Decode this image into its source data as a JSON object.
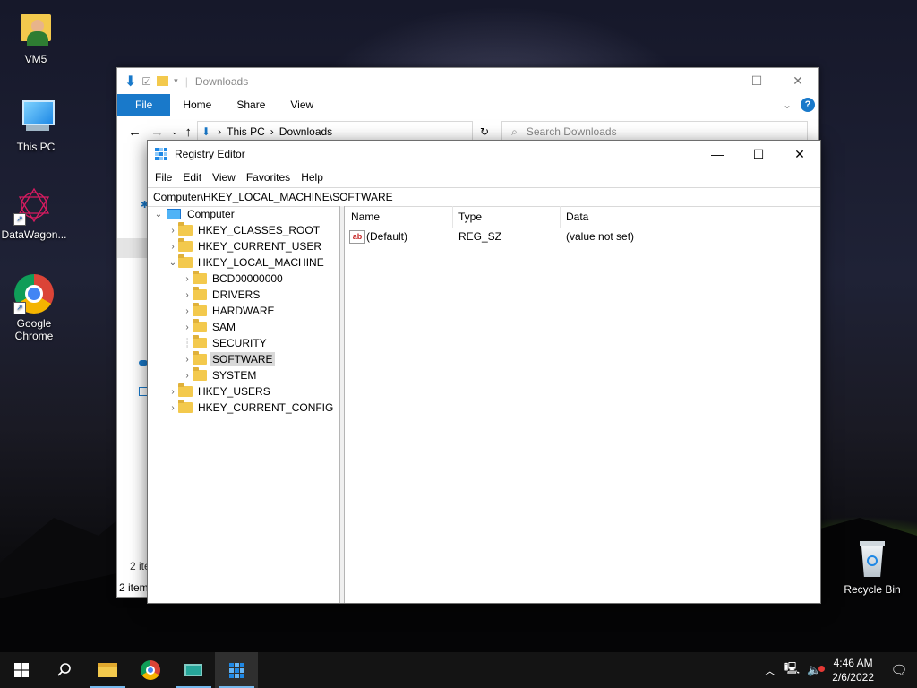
{
  "desktop": {
    "icons": [
      {
        "label": "VM5"
      },
      {
        "label": "This PC"
      },
      {
        "label": "DataWagon..."
      },
      {
        "label": "Google Chrome"
      },
      {
        "label": "Recycle Bin"
      }
    ]
  },
  "explorer": {
    "title": "Downloads",
    "ribbon": {
      "file": "File",
      "home": "Home",
      "share": "Share",
      "view": "View"
    },
    "path": {
      "root": "This PC",
      "current": "Downloads"
    },
    "search_placeholder": "Search Downloads",
    "status_a": "2 ite",
    "status_b": "2 item"
  },
  "regedit": {
    "title": "Registry Editor",
    "menu": {
      "file": "File",
      "edit": "Edit",
      "view": "View",
      "favorites": "Favorites",
      "help": "Help"
    },
    "address": "Computer\\HKEY_LOCAL_MACHINE\\SOFTWARE",
    "tree": {
      "computer": "Computer",
      "hkcr": "HKEY_CLASSES_ROOT",
      "hkcu": "HKEY_CURRENT_USER",
      "hklm": "HKEY_LOCAL_MACHINE",
      "bcd": "BCD00000000",
      "drivers": "DRIVERS",
      "hardware": "HARDWARE",
      "sam": "SAM",
      "security": "SECURITY",
      "software": "SOFTWARE",
      "system": "SYSTEM",
      "hku": "HKEY_USERS",
      "hkcc": "HKEY_CURRENT_CONFIG"
    },
    "columns": {
      "name": "Name",
      "type": "Type",
      "data": "Data"
    },
    "values": [
      {
        "name": "(Default)",
        "type": "REG_SZ",
        "data": "(value not set)"
      }
    ]
  },
  "taskbar": {
    "time": "4:46 AM",
    "date": "2/6/2022"
  },
  "colors": {
    "accent": "#1979ca",
    "selection": "#d9d9d9",
    "taskbar": "#141414"
  }
}
